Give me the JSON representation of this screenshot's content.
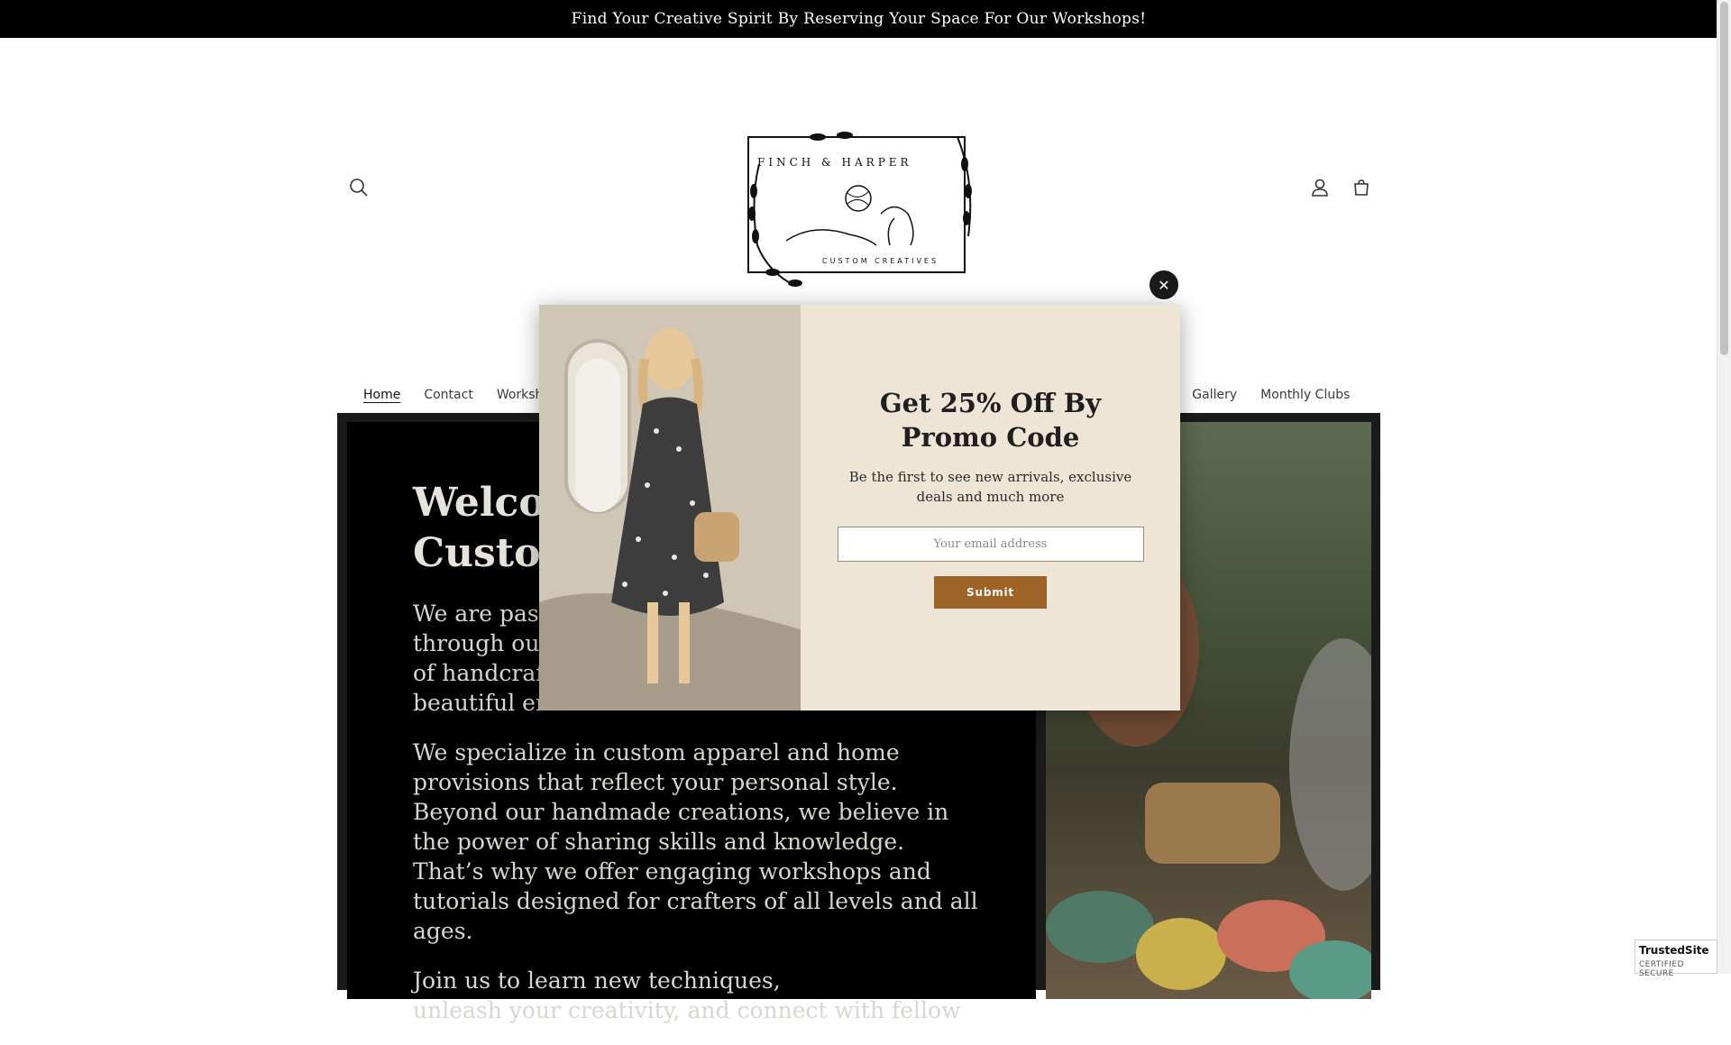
{
  "announcement": {
    "text": "Find Your Creative Spirit By Reserving Your Space For Our Workshops!"
  },
  "header": {
    "logo_text_top": "FINCH & HARPER",
    "logo_text_bottom": "CUSTOM CREATIVES",
    "icons": {
      "search": "search-icon",
      "account": "account-icon",
      "cart": "cart-icon"
    }
  },
  "nav": {
    "items": [
      {
        "label": "Home",
        "active": true
      },
      {
        "label": "Contact"
      },
      {
        "label": "Worksho"
      },
      {
        "label": "s"
      },
      {
        "label": "Gallery"
      },
      {
        "label": "Monthly Clubs"
      }
    ]
  },
  "hero": {
    "title_line1": "Welcom",
    "title_line2": "Custom",
    "p1_lines": [
      "We are passi",
      "through our",
      "of handcrafte",
      "beautiful em"
    ],
    "p2": "We specialize in custom apparel and home provisions that reflect your personal style. Beyond our handmade creations, we believe in the power of sharing skills and knowledge. That’s why we offer engaging workshops and tutorials designed for crafters of all levels and all ages.",
    "p3_line1": "Join us to learn new techniques,",
    "p3_line2": "unleash your creativity, and connect with fellow"
  },
  "popup": {
    "title": "Get 25% Off By Promo Code",
    "subtitle": "Be the first to see new arrivals, exclusive deals and much more",
    "email_placeholder": "Your email address",
    "submit_label": "Submit",
    "close_label": "✕"
  },
  "badge": {
    "line1": "TrustedSite",
    "line2": "CERTIFIED SECURE"
  },
  "colors": {
    "announcement_bg": "#000000",
    "popup_bg": "#efe5d6",
    "submit_bg": "#9e6427"
  }
}
